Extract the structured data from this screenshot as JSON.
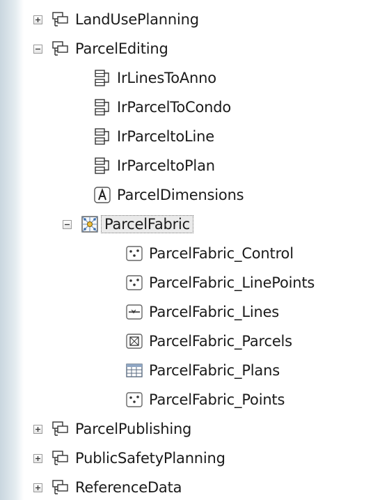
{
  "tree": {
    "items": [
      {
        "label": "LandUsePlanning",
        "icon": "feature-dataset-icon",
        "state": "collapsed"
      },
      {
        "label": "ParcelEditing",
        "icon": "feature-dataset-icon",
        "state": "expanded"
      },
      {
        "label": "IrLinesToAnno",
        "icon": "relationship-class-icon"
      },
      {
        "label": "IrParcelToCondo",
        "icon": "relationship-class-icon"
      },
      {
        "label": "IrParceltoLine",
        "icon": "relationship-class-icon"
      },
      {
        "label": "IrParceltoPlan",
        "icon": "relationship-class-icon"
      },
      {
        "label": "ParcelDimensions",
        "icon": "annotation-class-icon"
      },
      {
        "label": "ParcelFabric",
        "icon": "parcel-fabric-icon",
        "state": "expanded",
        "selected": true
      },
      {
        "label": "ParcelFabric_Control",
        "icon": "point-feature-class-icon"
      },
      {
        "label": "ParcelFabric_LinePoints",
        "icon": "point-feature-class-icon"
      },
      {
        "label": "ParcelFabric_Lines",
        "icon": "line-feature-class-icon"
      },
      {
        "label": "ParcelFabric_Parcels",
        "icon": "polygon-feature-class-icon"
      },
      {
        "label": "ParcelFabric_Plans",
        "icon": "table-icon"
      },
      {
        "label": "ParcelFabric_Points",
        "icon": "point-feature-class-icon"
      },
      {
        "label": "ParcelPublishing",
        "icon": "feature-dataset-icon",
        "state": "collapsed"
      },
      {
        "label": "PublicSafetyPlanning",
        "icon": "feature-dataset-icon",
        "state": "collapsed"
      },
      {
        "label": "ReferenceData",
        "icon": "feature-dataset-icon",
        "state": "collapsed"
      }
    ]
  },
  "colors": {
    "selection_bg": "#eaeaea",
    "icon_blue": "#3a6fb0",
    "text": "#1a1a1a"
  }
}
